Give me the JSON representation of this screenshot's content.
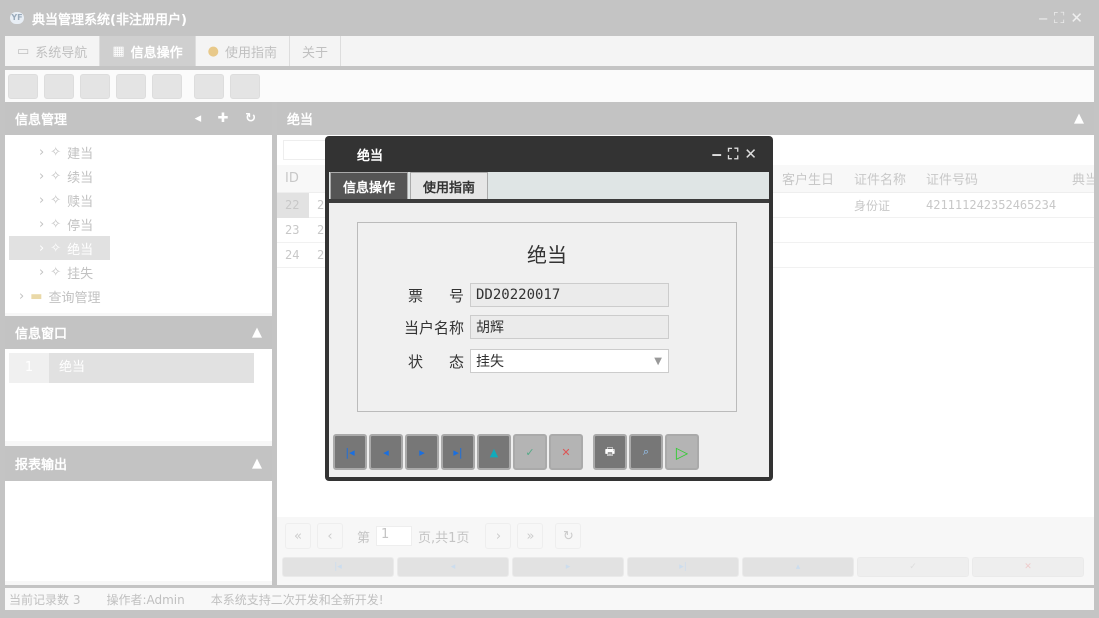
{
  "app": {
    "title": "典当管理系统(非注册用户)"
  },
  "tabs": [
    {
      "label": "系统导航"
    },
    {
      "label": "信息操作"
    },
    {
      "label": "使用指南"
    },
    {
      "label": "关于"
    }
  ],
  "left": {
    "title": "信息管理",
    "tree": [
      {
        "label": "建当"
      },
      {
        "label": "续当"
      },
      {
        "label": "赎当"
      },
      {
        "label": "停当"
      },
      {
        "label": "绝当"
      },
      {
        "label": "挂失"
      }
    ],
    "folder": "查询管理",
    "window_title": "信息窗口",
    "window_items": [
      {
        "num": "1",
        "label": "绝当"
      }
    ],
    "report_title": "报表输出"
  },
  "grid": {
    "title": "绝当",
    "columns": [
      "ID",
      "客户生日",
      "证件名称",
      "证件号码",
      "典当"
    ],
    "rows": [
      {
        "id": "22",
        "c2": "2",
        "id_type": "身份证",
        "id_no": "421111242352465234"
      },
      {
        "id": "23",
        "c2": "2"
      },
      {
        "id": "24",
        "c2": "2"
      }
    ]
  },
  "pager": {
    "prefix": "第",
    "page": "1",
    "suffix": "页,共1页"
  },
  "status": {
    "records": "当前记录数 3",
    "operator": "操作者:Admin",
    "note": "本系统支持二次开发和全新开发!"
  },
  "dialog": {
    "title": "绝当",
    "tabs": [
      "信息操作",
      "使用指南"
    ],
    "heading": "绝当",
    "fields": [
      {
        "label1": "票",
        "label2": "号",
        "value": "DD20220017"
      },
      {
        "label1": "当户名称",
        "label2": "",
        "value": "胡辉"
      },
      {
        "label1": "状",
        "label2": "态",
        "value": "挂失"
      }
    ]
  }
}
